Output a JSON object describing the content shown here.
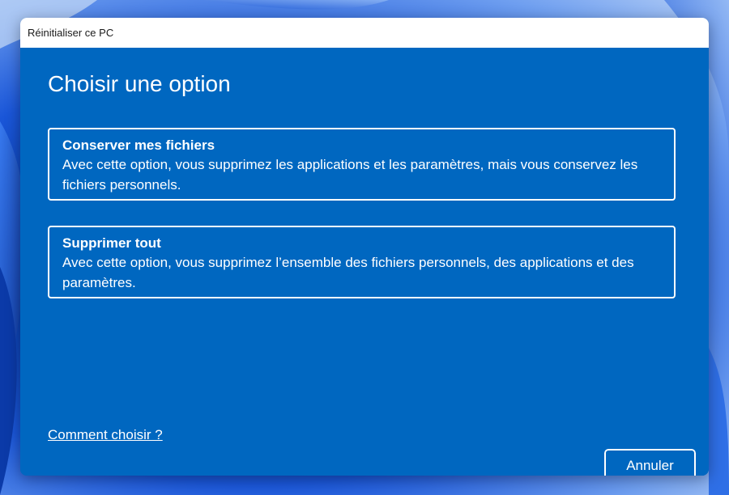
{
  "window": {
    "title": "Réinitialiser ce PC"
  },
  "main": {
    "heading": "Choisir une option",
    "options": [
      {
        "title": "Conserver mes fichiers",
        "description": "Avec cette option, vous supprimez les applications et les paramètres, mais vous conservez les fichiers personnels."
      },
      {
        "title": "Supprimer tout",
        "description": "Avec cette option, vous supprimez l’ensemble des fichiers personnels, des applications et des paramètres."
      }
    ]
  },
  "footer": {
    "help_link": "Comment choisir ?",
    "cancel_label": "Annuler"
  },
  "colors": {
    "dialog_background": "#0067c0",
    "titlebar_background": "#ffffff",
    "text": "#ffffff"
  }
}
